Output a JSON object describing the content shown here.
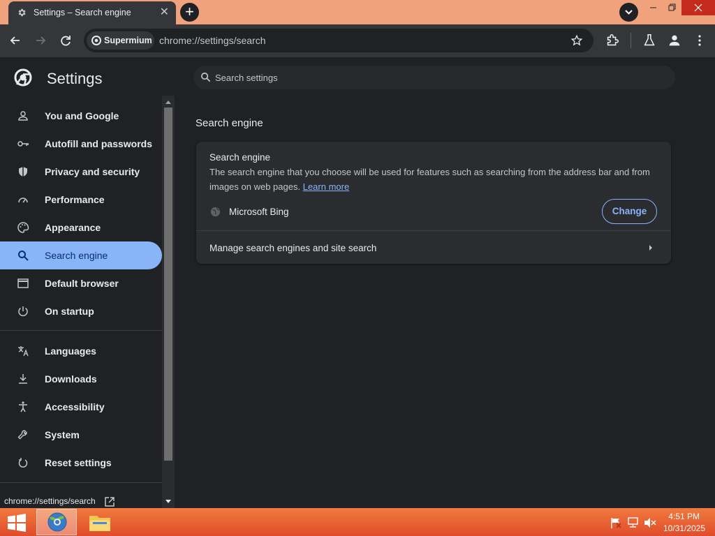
{
  "window": {
    "tab_title": "Settings – Search engine",
    "address_chip": "Supermium",
    "url": "chrome://settings/search"
  },
  "sidebar": {
    "title": "Settings",
    "items": [
      {
        "label": "You and Google",
        "icon": "person-icon"
      },
      {
        "label": "Autofill and passwords",
        "icon": "key-icon"
      },
      {
        "label": "Privacy and security",
        "icon": "shield-icon"
      },
      {
        "label": "Performance",
        "icon": "speedometer-icon"
      },
      {
        "label": "Appearance",
        "icon": "palette-icon"
      },
      {
        "label": "Search engine",
        "icon": "search-icon",
        "selected": true
      },
      {
        "label": "Default browser",
        "icon": "browser-window-icon"
      },
      {
        "label": "On startup",
        "icon": "power-icon"
      },
      {
        "label": "Languages",
        "icon": "translate-icon"
      },
      {
        "label": "Downloads",
        "icon": "download-icon"
      },
      {
        "label": "Accessibility",
        "icon": "accessibility-icon"
      },
      {
        "label": "System",
        "icon": "wrench-icon"
      },
      {
        "label": "Reset settings",
        "icon": "reset-icon"
      }
    ]
  },
  "status_bar": {
    "url": "chrome://settings/search"
  },
  "search": {
    "placeholder": "Search settings"
  },
  "main": {
    "section_title": "Search engine",
    "card": {
      "title": "Search engine",
      "description": "The search engine that you choose will be used for features such as searching from the address bar and from images on web pages.",
      "learn_more": "Learn more",
      "engine_name": "Microsoft Bing",
      "change_label": "Change",
      "manage_label": "Manage search engines and site search"
    }
  },
  "taskbar": {
    "time": "4:51 PM",
    "date": "10/31/2025"
  },
  "colors": {
    "accent": "#8ab4f8",
    "titlebar": "#f0a27c",
    "taskbar": "#e8602f"
  }
}
